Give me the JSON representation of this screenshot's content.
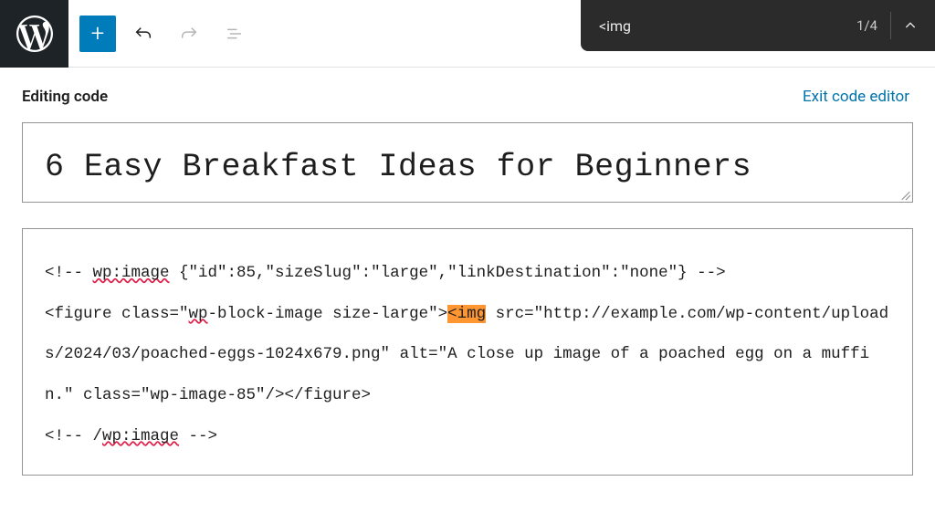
{
  "findbar": {
    "query": "<img",
    "count_label": "1/4"
  },
  "subheader": {
    "editing_label": "Editing code",
    "exit_label": "Exit code editor"
  },
  "title": "6 Easy Breakfast Ideas for Beginners",
  "code": {
    "line1a": "<!-- ",
    "line1b": "wp:image",
    "line1c": " {\"id\":85,\"sizeSlug\":\"large\",\"linkDestination\":\"none\"} -->",
    "line2a": "<figure class=\"",
    "line2b": "wp",
    "line2c": "-block-image size-large\">",
    "line2_hl": "<img",
    "line2d": " src=\"http://example.com/wp-content/uploads/2024/03/poached-eggs-1024x679.png\" alt=\"A close up image of a poached egg on a muffin.\" class=\"wp-image-85\"/></figure>",
    "line3a": "<!-- /",
    "line3b": "wp:image",
    "line3c": " -->"
  }
}
